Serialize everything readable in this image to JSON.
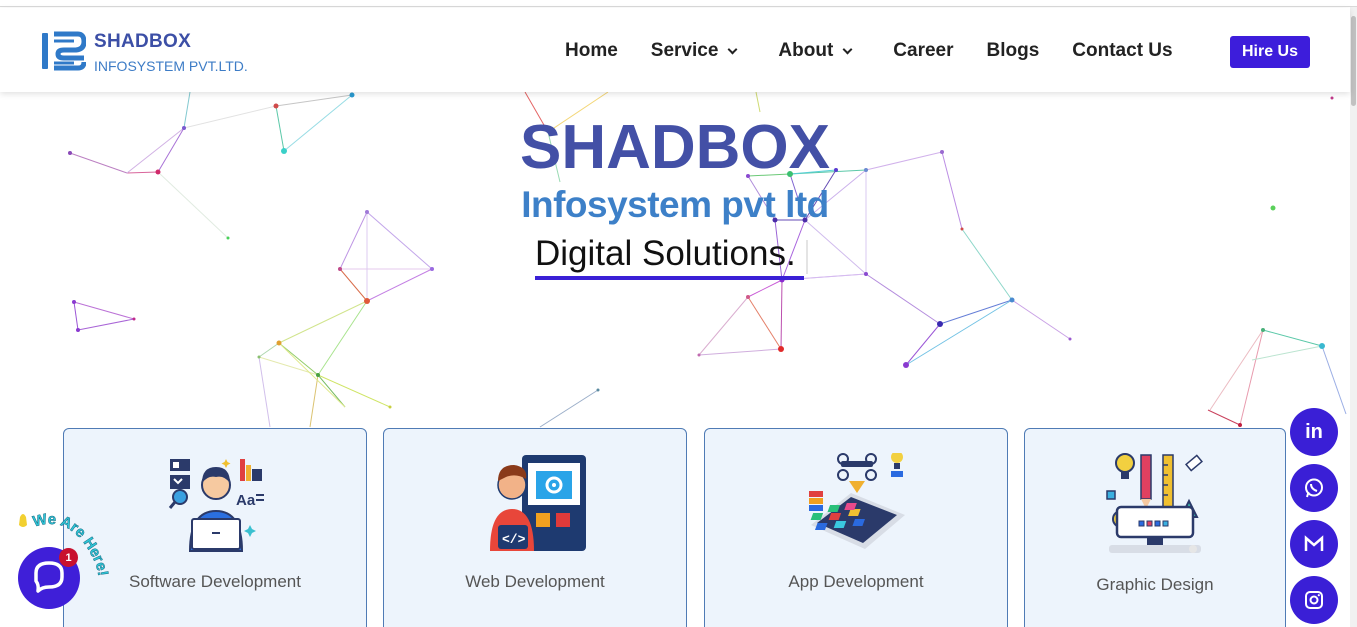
{
  "brand": {
    "title": "SHADBOX",
    "subtitle": "INFOSYSTEM PVT.LTD.",
    "primary_color": "#4350a6",
    "secondary_color": "#3d80c8",
    "accent_color": "#3a1fd6"
  },
  "nav": {
    "items": [
      {
        "label": "Home",
        "has_dropdown": false
      },
      {
        "label": "Service",
        "has_dropdown": true
      },
      {
        "label": "About",
        "has_dropdown": true
      },
      {
        "label": "Career",
        "has_dropdown": false
      },
      {
        "label": "Blogs",
        "has_dropdown": false
      },
      {
        "label": "Contact Us",
        "has_dropdown": false
      }
    ],
    "cta": "Hire Us"
  },
  "hero": {
    "title": "SHADBOX",
    "subtitle": "Infosystem pvt ltd",
    "tagline": "Digital Solutions."
  },
  "services": [
    {
      "label": "Software Development",
      "icon": "developer-laptop-icon"
    },
    {
      "label": "Web Development",
      "icon": "web-developer-icon"
    },
    {
      "label": "App Development",
      "icon": "app-drone-phone-icon"
    },
    {
      "label": "Graphic Design",
      "icon": "design-tools-icon"
    }
  ],
  "social": [
    {
      "name": "linkedin",
      "glyph": "in"
    },
    {
      "name": "whatsapp",
      "glyph": ""
    },
    {
      "name": "gmail",
      "glyph": "M"
    },
    {
      "name": "instagram",
      "glyph": ""
    }
  ],
  "chat": {
    "badge_count": "1",
    "banner": "We Are Here!"
  }
}
